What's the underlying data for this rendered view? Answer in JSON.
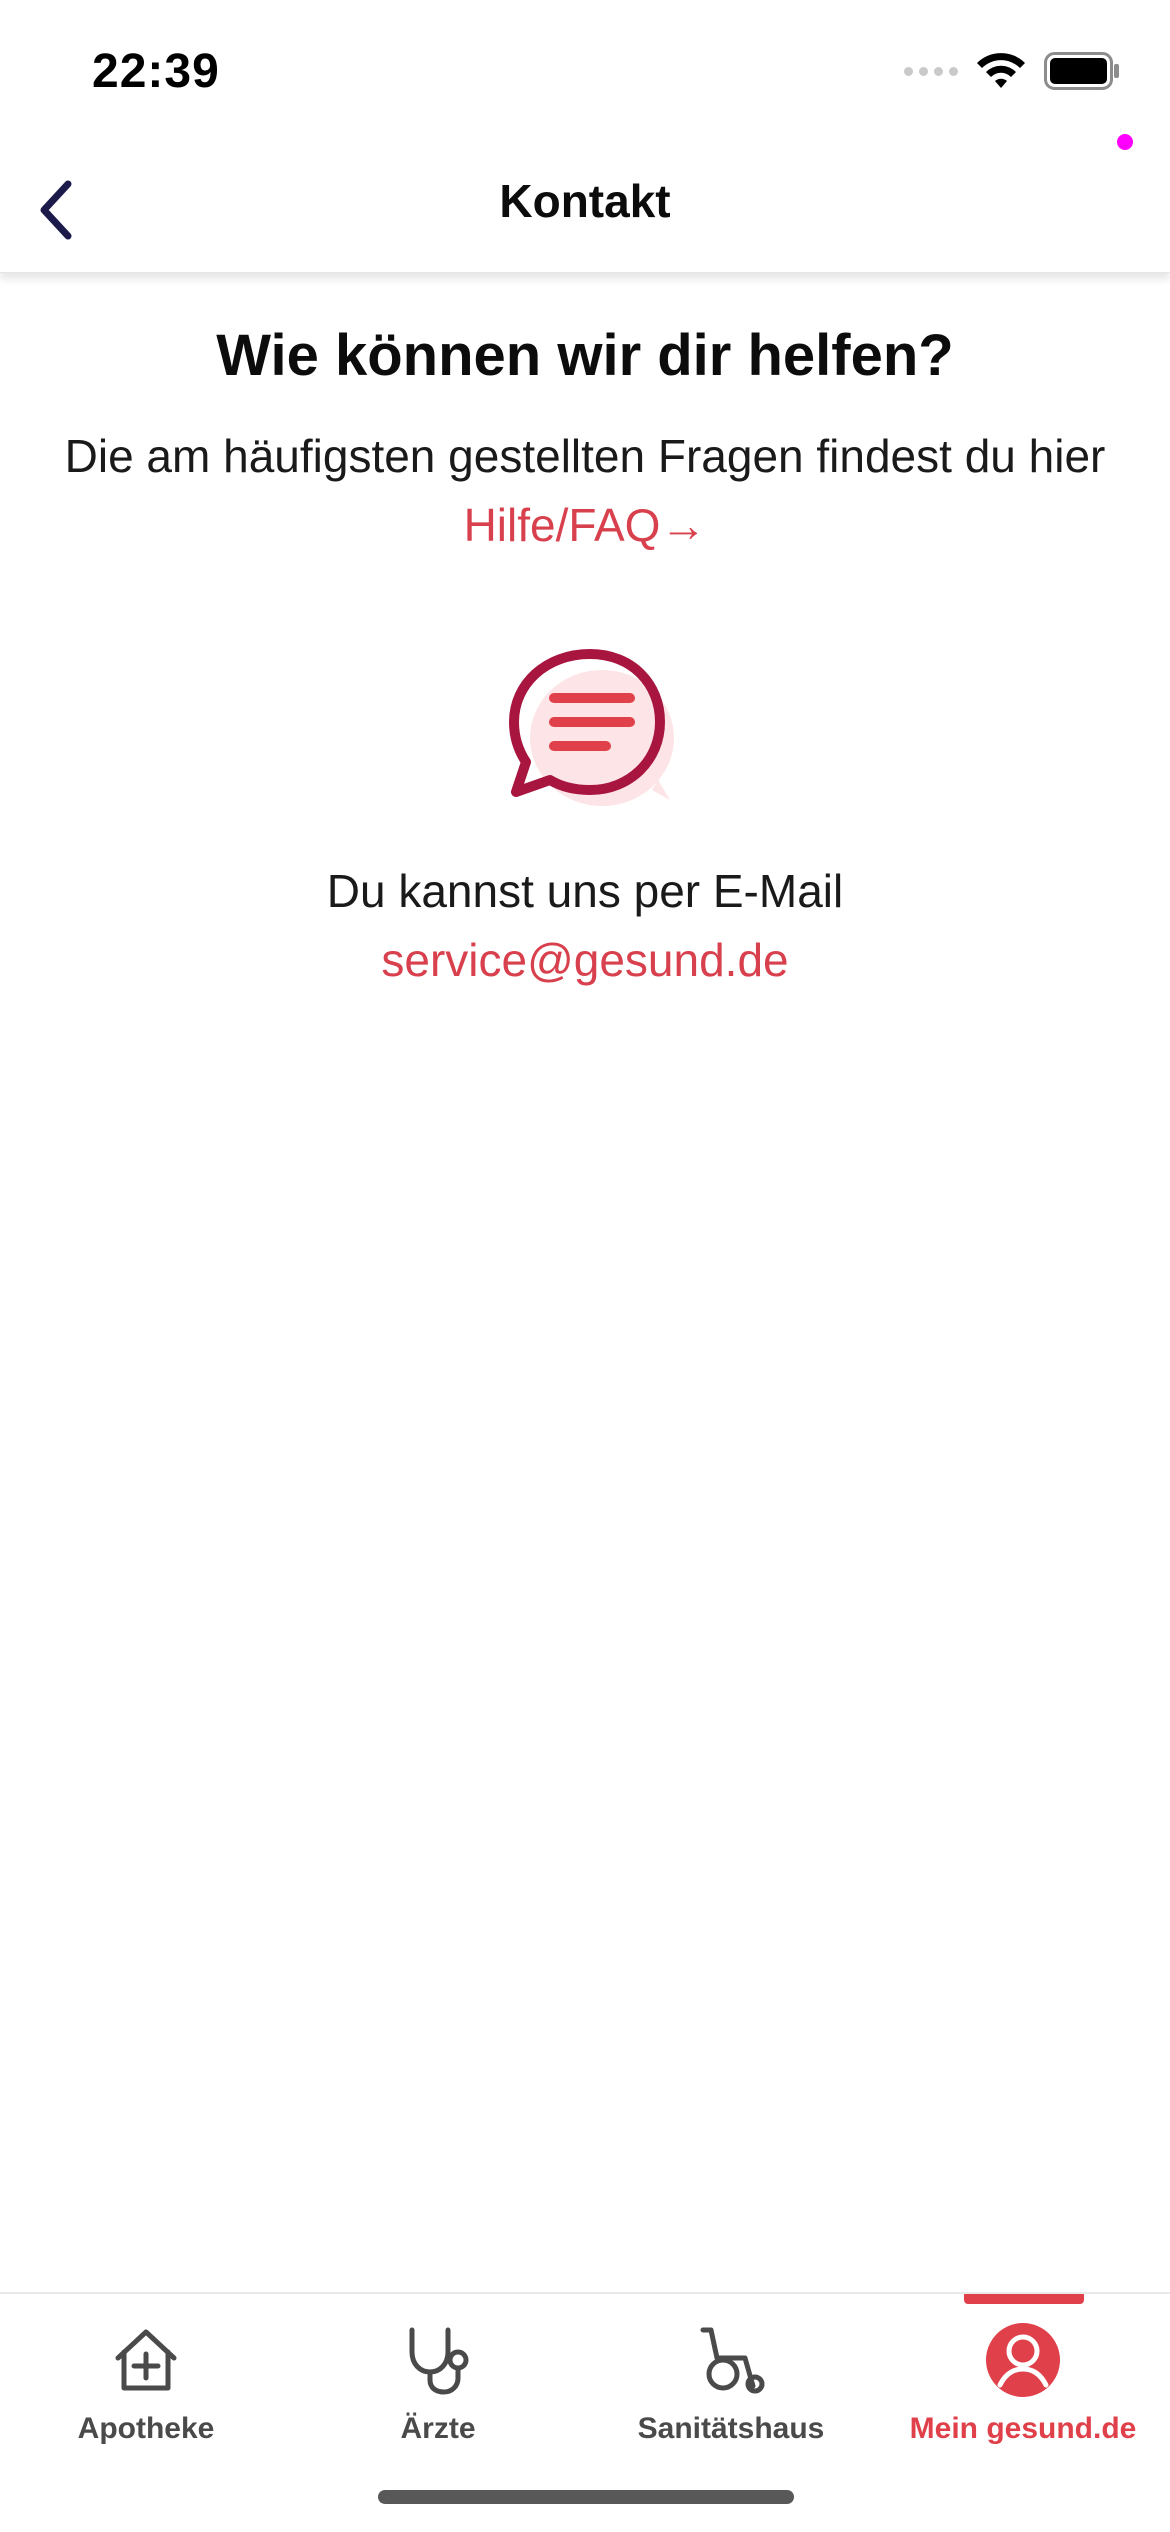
{
  "status_bar": {
    "time": "22:39"
  },
  "header": {
    "title": "Kontakt",
    "back_icon": "chevron-left-icon"
  },
  "main": {
    "headline": "Wie können wir dir helfen?",
    "faq_prefix": "Die am häufigsten gestellten Fragen findest du hier ",
    "faq_link": "Hilfe/FAQ→",
    "chat_icon": "chat-bubble-icon",
    "email_prefix": "Du kannst uns per E-Mail",
    "email_link": "service@gesund.de"
  },
  "tabs": [
    {
      "label": "Apotheke",
      "icon": "pharmacy-house-icon",
      "active": false
    },
    {
      "label": "Ärzte",
      "icon": "stethoscope-icon",
      "active": false
    },
    {
      "label": "Sanitätshaus",
      "icon": "wheelchair-icon",
      "active": false
    },
    {
      "label": "Mein gesund.de",
      "icon": "profile-icon",
      "active": true
    }
  ],
  "colors": {
    "accent": "#e0404a",
    "link": "#d8404d",
    "icon_dark": "#a8153f",
    "icon_light": "#fde4e6"
  }
}
